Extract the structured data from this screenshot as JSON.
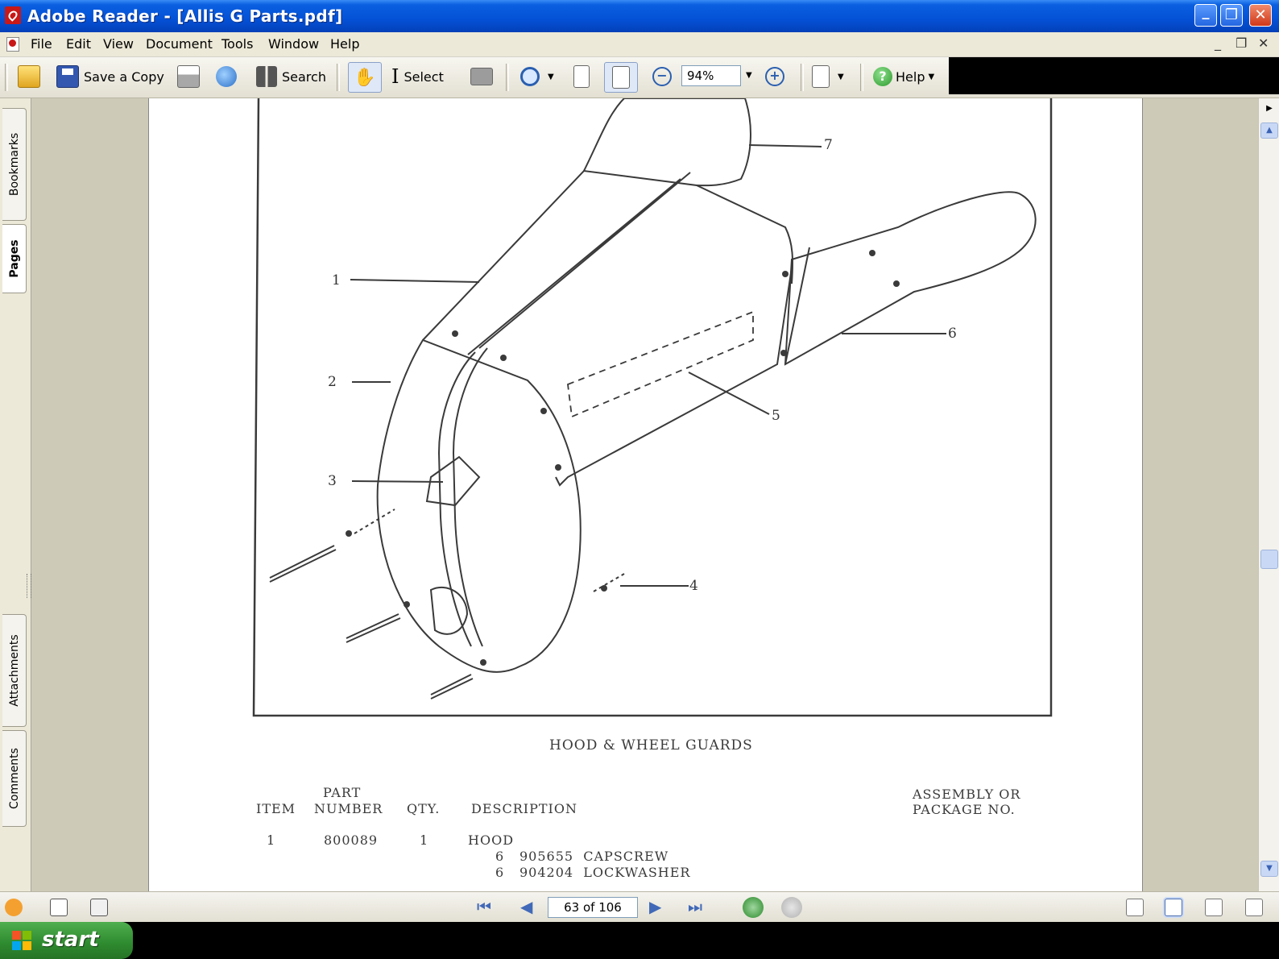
{
  "window": {
    "title": "Adobe Reader - [Allis G Parts.pdf]"
  },
  "menubar": {
    "items": [
      "File",
      "Edit",
      "View",
      "Document",
      "Tools",
      "Window",
      "Help"
    ],
    "mdi_controls": [
      "_",
      "❐",
      "✕"
    ]
  },
  "toolbar": {
    "save_copy_label": "Save a Copy",
    "search_label": "Search",
    "select_label": "Select",
    "zoom_value": "94%",
    "help_label": "Help"
  },
  "nav_panel": {
    "tabs": [
      "Bookmarks",
      "Pages",
      "Attachments",
      "Comments"
    ]
  },
  "document": {
    "callouts": [
      "1",
      "2",
      "3",
      "4",
      "5",
      "6",
      "7"
    ],
    "caption": "HOOD & WHEEL GUARDS",
    "table": {
      "headers": {
        "item": "ITEM",
        "part_line1": "PART",
        "part_line2": "NUMBER",
        "qty": "QTY.",
        "description": "DESCRIPTION",
        "assembly_line1": "ASSEMBLY OR",
        "assembly_line2": "PACKAGE NO."
      },
      "rows": [
        {
          "item": "1",
          "part_number": "800089",
          "qty": "1",
          "description": "HOOD"
        },
        {
          "item": "",
          "part_number": "",
          "qty": "6",
          "description": "905655  CAPSCREW"
        },
        {
          "item": "",
          "part_number": "",
          "qty": "6",
          "description": "904204  LOCKWASHER"
        }
      ]
    }
  },
  "statusbar": {
    "page_indicator": "63 of 106"
  },
  "taskbar": {
    "start_label": "start"
  }
}
